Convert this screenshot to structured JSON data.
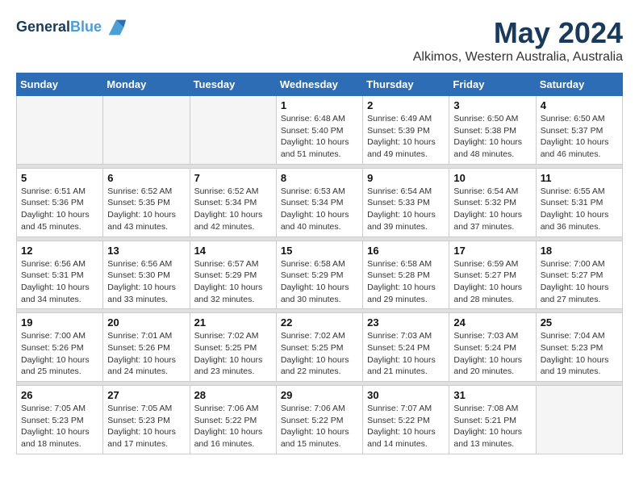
{
  "header": {
    "logo_line1": "General",
    "logo_line2": "Blue",
    "month": "May 2024",
    "location": "Alkimos, Western Australia, Australia"
  },
  "weekdays": [
    "Sunday",
    "Monday",
    "Tuesday",
    "Wednesday",
    "Thursday",
    "Friday",
    "Saturday"
  ],
  "weeks": [
    [
      {
        "day": "",
        "info": ""
      },
      {
        "day": "",
        "info": ""
      },
      {
        "day": "",
        "info": ""
      },
      {
        "day": "1",
        "info": "Sunrise: 6:48 AM\nSunset: 5:40 PM\nDaylight: 10 hours\nand 51 minutes."
      },
      {
        "day": "2",
        "info": "Sunrise: 6:49 AM\nSunset: 5:39 PM\nDaylight: 10 hours\nand 49 minutes."
      },
      {
        "day": "3",
        "info": "Sunrise: 6:50 AM\nSunset: 5:38 PM\nDaylight: 10 hours\nand 48 minutes."
      },
      {
        "day": "4",
        "info": "Sunrise: 6:50 AM\nSunset: 5:37 PM\nDaylight: 10 hours\nand 46 minutes."
      }
    ],
    [
      {
        "day": "5",
        "info": "Sunrise: 6:51 AM\nSunset: 5:36 PM\nDaylight: 10 hours\nand 45 minutes."
      },
      {
        "day": "6",
        "info": "Sunrise: 6:52 AM\nSunset: 5:35 PM\nDaylight: 10 hours\nand 43 minutes."
      },
      {
        "day": "7",
        "info": "Sunrise: 6:52 AM\nSunset: 5:34 PM\nDaylight: 10 hours\nand 42 minutes."
      },
      {
        "day": "8",
        "info": "Sunrise: 6:53 AM\nSunset: 5:34 PM\nDaylight: 10 hours\nand 40 minutes."
      },
      {
        "day": "9",
        "info": "Sunrise: 6:54 AM\nSunset: 5:33 PM\nDaylight: 10 hours\nand 39 minutes."
      },
      {
        "day": "10",
        "info": "Sunrise: 6:54 AM\nSunset: 5:32 PM\nDaylight: 10 hours\nand 37 minutes."
      },
      {
        "day": "11",
        "info": "Sunrise: 6:55 AM\nSunset: 5:31 PM\nDaylight: 10 hours\nand 36 minutes."
      }
    ],
    [
      {
        "day": "12",
        "info": "Sunrise: 6:56 AM\nSunset: 5:31 PM\nDaylight: 10 hours\nand 34 minutes."
      },
      {
        "day": "13",
        "info": "Sunrise: 6:56 AM\nSunset: 5:30 PM\nDaylight: 10 hours\nand 33 minutes."
      },
      {
        "day": "14",
        "info": "Sunrise: 6:57 AM\nSunset: 5:29 PM\nDaylight: 10 hours\nand 32 minutes."
      },
      {
        "day": "15",
        "info": "Sunrise: 6:58 AM\nSunset: 5:29 PM\nDaylight: 10 hours\nand 30 minutes."
      },
      {
        "day": "16",
        "info": "Sunrise: 6:58 AM\nSunset: 5:28 PM\nDaylight: 10 hours\nand 29 minutes."
      },
      {
        "day": "17",
        "info": "Sunrise: 6:59 AM\nSunset: 5:27 PM\nDaylight: 10 hours\nand 28 minutes."
      },
      {
        "day": "18",
        "info": "Sunrise: 7:00 AM\nSunset: 5:27 PM\nDaylight: 10 hours\nand 27 minutes."
      }
    ],
    [
      {
        "day": "19",
        "info": "Sunrise: 7:00 AM\nSunset: 5:26 PM\nDaylight: 10 hours\nand 25 minutes."
      },
      {
        "day": "20",
        "info": "Sunrise: 7:01 AM\nSunset: 5:26 PM\nDaylight: 10 hours\nand 24 minutes."
      },
      {
        "day": "21",
        "info": "Sunrise: 7:02 AM\nSunset: 5:25 PM\nDaylight: 10 hours\nand 23 minutes."
      },
      {
        "day": "22",
        "info": "Sunrise: 7:02 AM\nSunset: 5:25 PM\nDaylight: 10 hours\nand 22 minutes."
      },
      {
        "day": "23",
        "info": "Sunrise: 7:03 AM\nSunset: 5:24 PM\nDaylight: 10 hours\nand 21 minutes."
      },
      {
        "day": "24",
        "info": "Sunrise: 7:03 AM\nSunset: 5:24 PM\nDaylight: 10 hours\nand 20 minutes."
      },
      {
        "day": "25",
        "info": "Sunrise: 7:04 AM\nSunset: 5:23 PM\nDaylight: 10 hours\nand 19 minutes."
      }
    ],
    [
      {
        "day": "26",
        "info": "Sunrise: 7:05 AM\nSunset: 5:23 PM\nDaylight: 10 hours\nand 18 minutes."
      },
      {
        "day": "27",
        "info": "Sunrise: 7:05 AM\nSunset: 5:23 PM\nDaylight: 10 hours\nand 17 minutes."
      },
      {
        "day": "28",
        "info": "Sunrise: 7:06 AM\nSunset: 5:22 PM\nDaylight: 10 hours\nand 16 minutes."
      },
      {
        "day": "29",
        "info": "Sunrise: 7:06 AM\nSunset: 5:22 PM\nDaylight: 10 hours\nand 15 minutes."
      },
      {
        "day": "30",
        "info": "Sunrise: 7:07 AM\nSunset: 5:22 PM\nDaylight: 10 hours\nand 14 minutes."
      },
      {
        "day": "31",
        "info": "Sunrise: 7:08 AM\nSunset: 5:21 PM\nDaylight: 10 hours\nand 13 minutes."
      },
      {
        "day": "",
        "info": ""
      }
    ]
  ]
}
